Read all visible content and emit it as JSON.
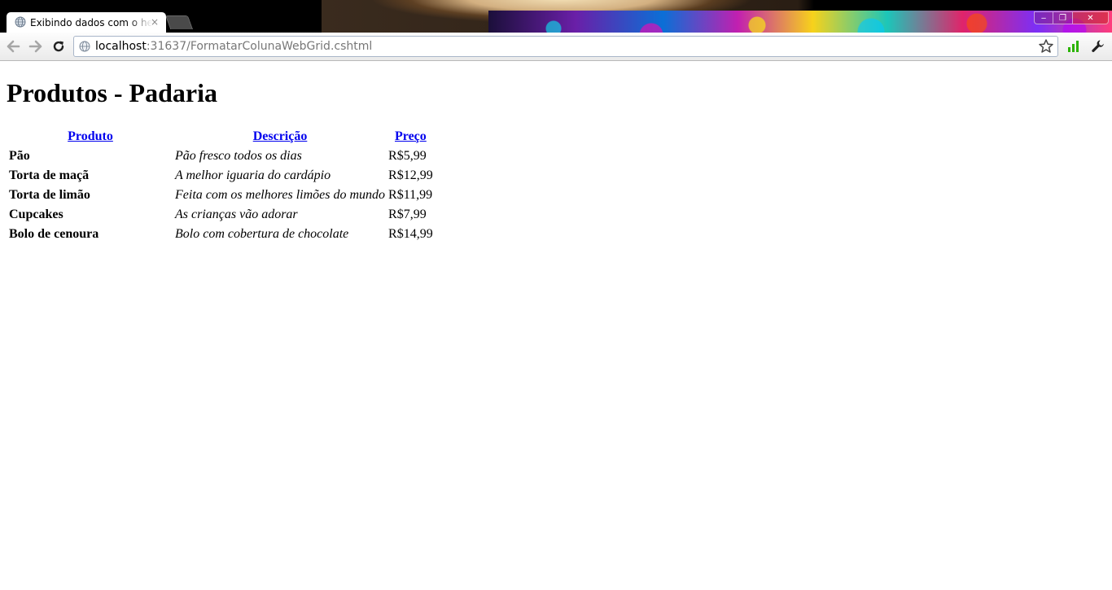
{
  "browser": {
    "tab": {
      "title": "Exibindo dados com o helper WebGrid",
      "close_glyph": "×"
    },
    "window_buttons": {
      "minimize": "‒",
      "maximize": "❐",
      "close": "✕"
    },
    "address": {
      "host": "localhost",
      "rest": ":31637/FormatarColunaWebGrid.cshtml"
    },
    "colors": {
      "link": "#0000ee",
      "signal": "#2bb300"
    }
  },
  "page": {
    "title": "Produtos - Padaria",
    "grid": {
      "columns": [
        "Produto",
        "Descrição",
        "Preço"
      ],
      "rows": [
        {
          "produto": "Pão",
          "descricao": "Pão fresco todos os dias",
          "preco": "R$5,99"
        },
        {
          "produto": "Torta de maçã",
          "descricao": "A melhor iguaria do cardápio",
          "preco": "R$12,99"
        },
        {
          "produto": "Torta de limão",
          "descricao": "Feita com os melhores limões do mundo",
          "preco": "R$11,99"
        },
        {
          "produto": "Cupcakes",
          "descricao": "As crianças vão adorar",
          "preco": "R$7,99"
        },
        {
          "produto": "Bolo de cenoura",
          "descricao": "Bolo com cobertura de chocolate",
          "preco": "R$14,99"
        }
      ]
    }
  }
}
